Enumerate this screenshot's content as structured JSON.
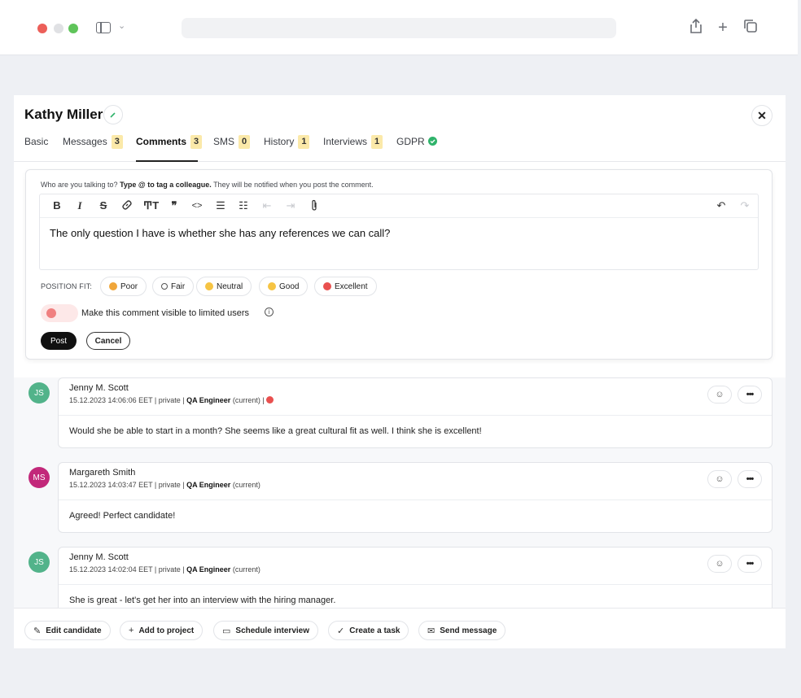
{
  "candidate": {
    "name": "Kathy Miller"
  },
  "tabs": [
    {
      "label": "Basic",
      "count": null
    },
    {
      "label": "Messages",
      "count": "3"
    },
    {
      "label": "Comments",
      "count": "3"
    },
    {
      "label": "SMS",
      "count": "0"
    },
    {
      "label": "History",
      "count": "1"
    },
    {
      "label": "Interviews",
      "count": "1"
    },
    {
      "label": "GDPR",
      "count": null
    }
  ],
  "composer": {
    "helper_prefix": "Who are you talking to?",
    "helper_bold": "Type @ to tag a colleague.",
    "helper_suffix": "They will be notified when you post the comment.",
    "text": "The only question I have is whether she has any references we can call?",
    "fit_label": "POSITION FIT:",
    "fit_options": [
      {
        "label": "Poor",
        "color": "#f0a63a"
      },
      {
        "label": "Fair",
        "color": "#ffffff"
      },
      {
        "label": "Neutral",
        "color": "#f6c443"
      },
      {
        "label": "Good",
        "color": "#f6c443"
      },
      {
        "label": "Excellent",
        "color": "#e9504f"
      }
    ],
    "visibility_label": "Make this comment visible to limited users",
    "post_label": "Post",
    "cancel_label": "Cancel"
  },
  "comments": [
    {
      "initials": "JS",
      "avatar_color": "#52b38a",
      "author": "Jenny M. Scott",
      "meta": "15.12.2023 14:06:06 EET | private |",
      "role": "QA Engineer",
      "role_suffix": "(current) |",
      "body": "Would she be able to start in a month? She seems like a great cultural fit as well. I think she is excellent!"
    },
    {
      "initials": "MS",
      "avatar_color": "#c2287a",
      "author": "Margareth Smith",
      "meta": "15.12.2023 14:03:47 EET | private |",
      "role": "QA Engineer",
      "role_suffix": "(current)",
      "body": "Agreed! Perfect candidate!"
    },
    {
      "initials": "JS",
      "avatar_color": "#52b38a",
      "author": "Jenny M. Scott",
      "meta": "15.12.2023 14:02:04 EET | private |",
      "role": "QA Engineer",
      "role_suffix": "(current)",
      "body": "She is great - let's get her into an interview with the hiring manager."
    }
  ],
  "footer": {
    "edit": "Edit candidate",
    "add_project": "Add to project",
    "schedule": "Schedule interview",
    "task": "Create a task",
    "message": "Send message"
  },
  "colors": {
    "accent": "#111111",
    "badge": "#fbe9a9",
    "gdpr_check": "#2fb36b"
  }
}
